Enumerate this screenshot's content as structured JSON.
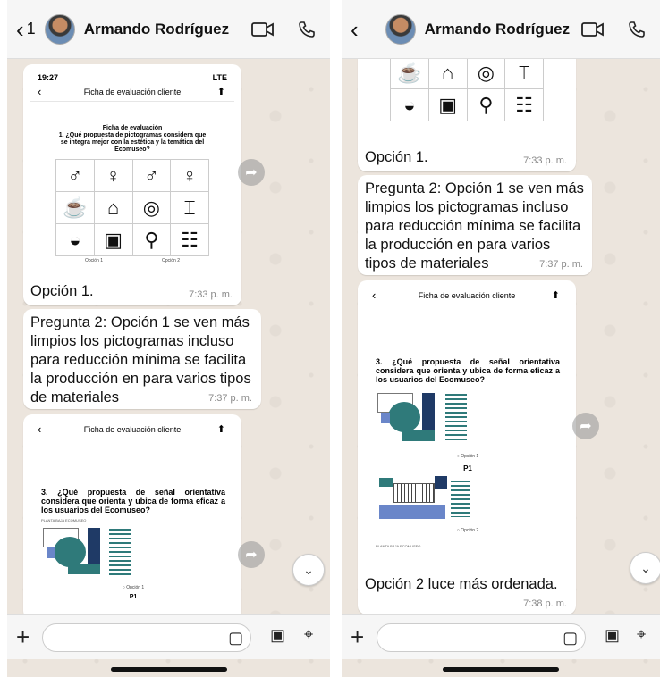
{
  "contact_name": "Armando Rodríguez",
  "back_count": "1",
  "messages": {
    "opcion1": {
      "text": "Opción 1.",
      "time": "7:33 p. m."
    },
    "pregunta2": {
      "text": "Pregunta 2: Opción 1 se ven más limpios los pictogramas incluso para reducción mínima se facilita la producción en para varios tipos de materiales",
      "time": "7:37 p. m."
    },
    "opcion2": {
      "text": "Opción 2 luce más ordenada.",
      "time": "7:38 p. m."
    }
  },
  "screenshot1": {
    "status_time": "19:27",
    "status_right": "LTE",
    "nav_title": "Ficha de evaluación cliente",
    "doc_title": "Ficha de evaluación",
    "question": "1. ¿Qué propuesta de pictogramas considera que se integra mejor con la estética y la temática del Ecomuseo?",
    "opt1": "Opción 1",
    "opt2": "Opción 2"
  },
  "screenshot2": {
    "nav_title": "Ficha de evaluación cliente",
    "question": "3. ¿Qué propuesta de señal orientativa considera que orienta y ubica de forma eficaz a los usuarios del Ecomuseo?",
    "map_caption": "PLANTA BAJA ECOMUSEO",
    "opt1": "○ Opción 1",
    "opt2": "○ Opción 2",
    "p1": "P1"
  },
  "icons": {
    "video": "video-camera-icon",
    "phone": "phone-icon",
    "forward": "forward-icon",
    "scroll_down": "chevron-down-icon",
    "sticker": "sticker-icon",
    "camera": "camera-icon",
    "mic": "microphone-icon"
  },
  "colors": {
    "header": "#f6f6f6",
    "wallpaper": "#ece5dd",
    "bubble": "#ffffff",
    "map_teal": "#2f7a7a",
    "map_navy": "#1f3a66"
  }
}
